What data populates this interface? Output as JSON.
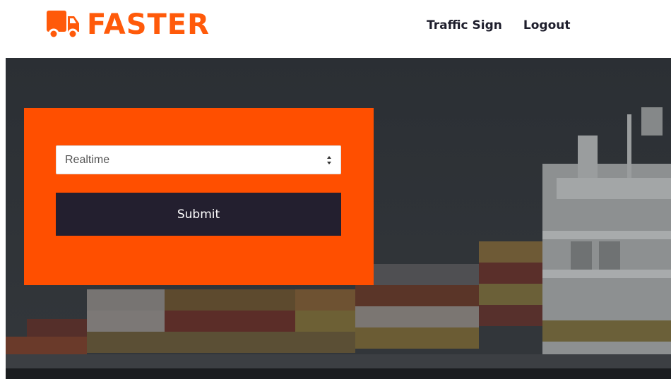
{
  "brand": {
    "name": "FASTER",
    "icon": "truck-icon",
    "color": "#ff5a0a"
  },
  "nav": {
    "links": [
      {
        "label": "Traffic Sign"
      },
      {
        "label": "Logout"
      }
    ]
  },
  "form": {
    "panel_color": "#ff4f00",
    "select": {
      "value": "Realtime",
      "icon": "select-arrows-icon"
    },
    "submit": {
      "label": "Submit",
      "color": "#231f2f"
    }
  },
  "hero": {
    "background": "container-ship-image"
  }
}
